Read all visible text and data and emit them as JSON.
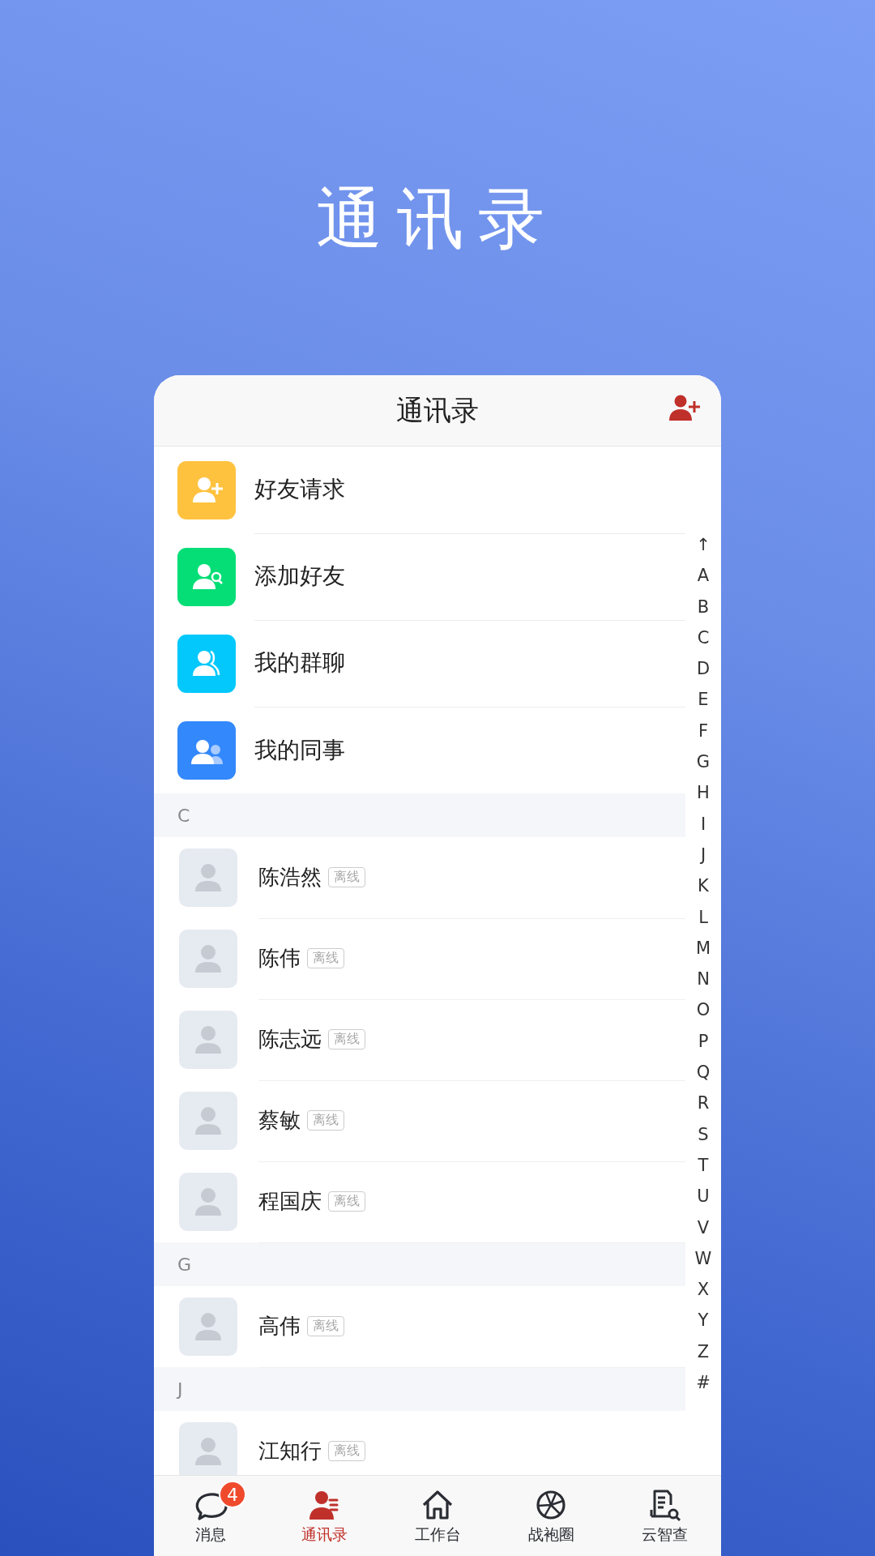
{
  "banner_title": "通讯录",
  "header": {
    "title": "通讯录"
  },
  "functions": [
    {
      "label": "好友请求",
      "kind": "friend-request",
      "color": "#ffc23f"
    },
    {
      "label": "添加好友",
      "kind": "add-friend",
      "color": "#05de76"
    },
    {
      "label": "我的群聊",
      "kind": "group-chat",
      "color": "#03c8fb"
    },
    {
      "label": "我的同事",
      "kind": "colleagues",
      "color": "#3388fc"
    }
  ],
  "sections": [
    {
      "letter": "C",
      "contacts": [
        {
          "name": "陈浩然",
          "status": "离线"
        },
        {
          "name": "陈伟",
          "status": "离线"
        },
        {
          "name": "陈志远",
          "status": "离线"
        },
        {
          "name": "蔡敏",
          "status": "离线"
        },
        {
          "name": "程国庆",
          "status": "离线"
        }
      ]
    },
    {
      "letter": "G",
      "contacts": [
        {
          "name": "高伟",
          "status": "离线"
        }
      ]
    },
    {
      "letter": "J",
      "contacts": [
        {
          "name": "江知行",
          "status": "离线"
        }
      ]
    }
  ],
  "index_letters": [
    "↑",
    "A",
    "B",
    "C",
    "D",
    "E",
    "F",
    "G",
    "H",
    "I",
    "J",
    "K",
    "L",
    "M",
    "N",
    "O",
    "P",
    "Q",
    "R",
    "S",
    "T",
    "U",
    "V",
    "W",
    "X",
    "Y",
    "Z",
    "#"
  ],
  "tabs": [
    {
      "label": "消息",
      "kind": "messages",
      "selected": false,
      "badge": "4"
    },
    {
      "label": "通讯录",
      "kind": "contacts",
      "selected": true
    },
    {
      "label": "工作台",
      "kind": "workbench",
      "selected": false
    },
    {
      "label": "战袍圈",
      "kind": "moments",
      "selected": false
    },
    {
      "label": "云智查",
      "kind": "search-docs",
      "selected": false
    }
  ]
}
